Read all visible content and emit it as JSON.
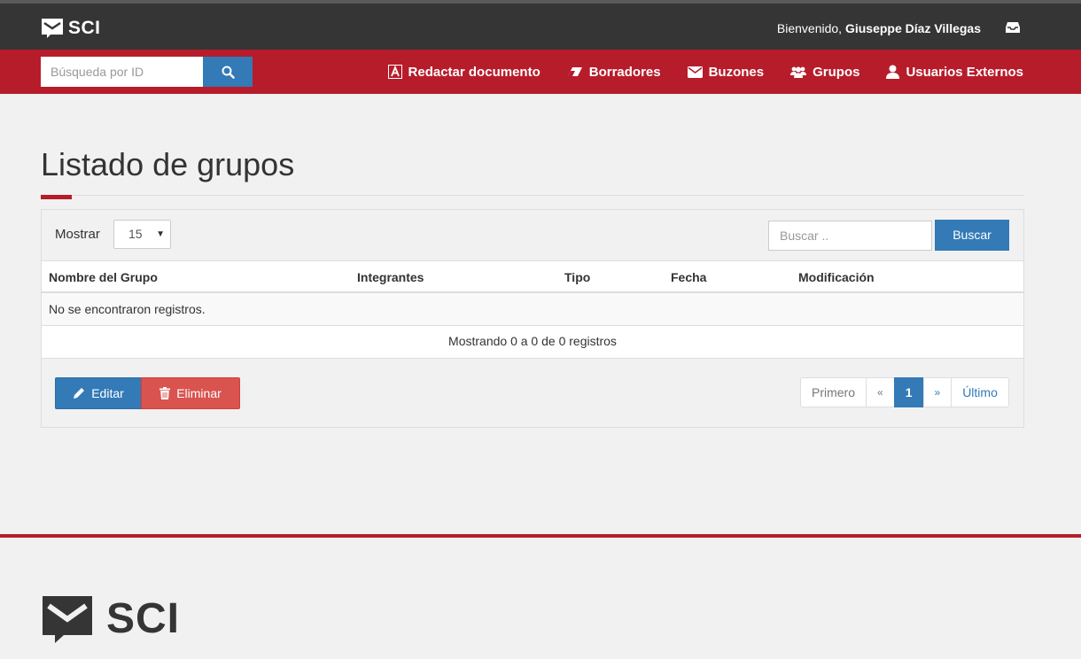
{
  "brand": {
    "name": "SCI"
  },
  "header": {
    "welcome_prefix": "Bienvenido, ",
    "user_name": "Giuseppe Díaz Villegas"
  },
  "navbar": {
    "search_placeholder": "Búsqueda por ID",
    "items": [
      {
        "label": "Redactar documento",
        "icon": "font-icon"
      },
      {
        "label": "Borradores",
        "icon": "eraser-icon"
      },
      {
        "label": "Buzones",
        "icon": "envelope-icon"
      },
      {
        "label": "Grupos",
        "icon": "users-icon"
      },
      {
        "label": "Usuarios Externos",
        "icon": "user-icon"
      }
    ]
  },
  "page": {
    "title": "Listado de grupos"
  },
  "list": {
    "show_label": "Mostrar",
    "page_size": "15",
    "search_placeholder": "Buscar ..",
    "search_button": "Buscar",
    "columns": [
      "Nombre del Grupo",
      "Integrantes",
      "Tipo",
      "Fecha",
      "Modificación"
    ],
    "empty_message": "No se encontraron registros.",
    "info": "Mostrando 0 a 0 de 0 registros",
    "edit_button": "Editar",
    "delete_button": "Eliminar",
    "pagination": {
      "first": "Primero",
      "prev": "«",
      "current": "1",
      "next": "»",
      "last": "Último"
    }
  },
  "colors": {
    "topbar": "#353535",
    "navbar": "#b71c2b",
    "primary": "#337ab7",
    "danger": "#d9534f"
  }
}
